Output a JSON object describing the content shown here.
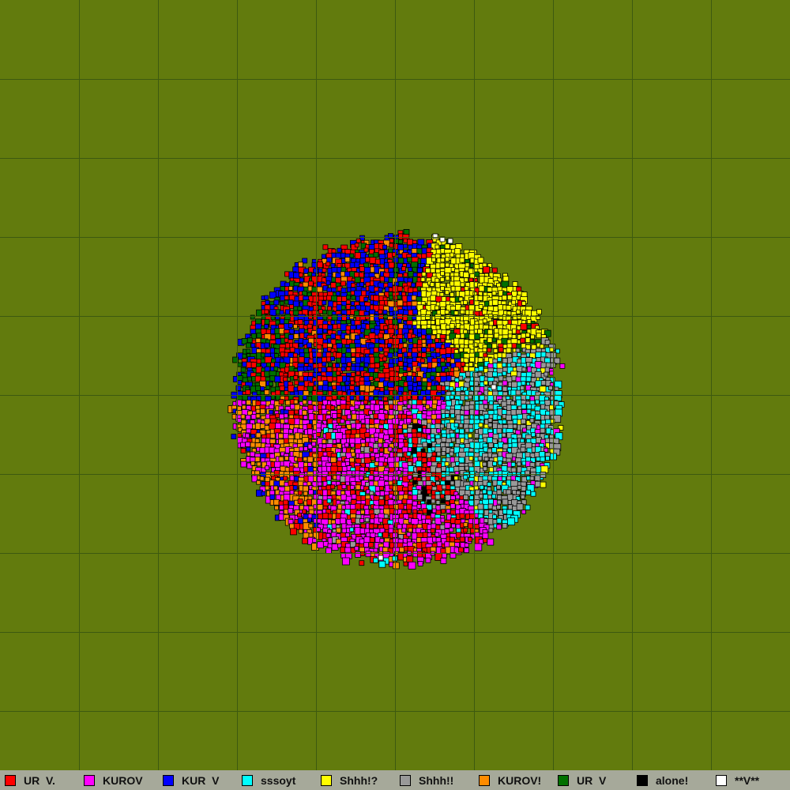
{
  "colors": {
    "background": "#627b0d",
    "grid_line": "#3d5a0f",
    "legend_bg": "#a6a99a"
  },
  "legend": [
    {
      "label": "UR  V.",
      "color": "#ff0000"
    },
    {
      "label": "KUROV",
      "color": "#ff00ff"
    },
    {
      "label": "KUR  V",
      "color": "#0000ff"
    },
    {
      "label": "sssoyt",
      "color": "#00ffff"
    },
    {
      "label": "Shhh!?",
      "color": "#ffff00"
    },
    {
      "label": "Shhh!!",
      "color": "#999999"
    },
    {
      "label": "KUROV!",
      "color": "#ff8c00"
    },
    {
      "label": "UR  V",
      "color": "#007000"
    },
    {
      "label": "alone!",
      "color": "#000000"
    },
    {
      "label": "**V**",
      "color": "#ffffff"
    }
  ]
}
